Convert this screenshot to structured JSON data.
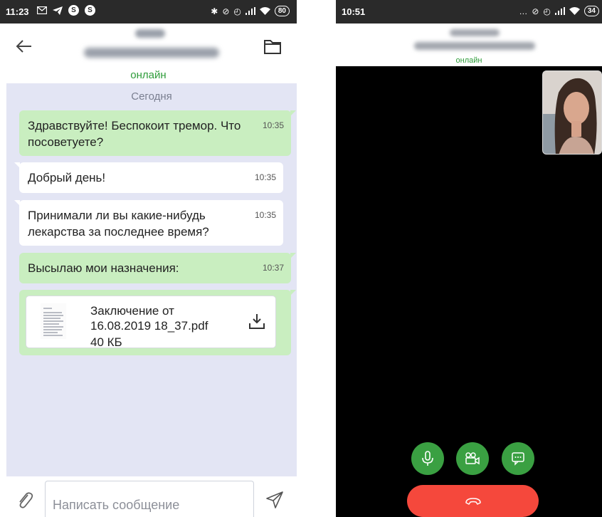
{
  "left": {
    "status_bar": {
      "time": "11:23",
      "battery": "80",
      "s1": "S",
      "s2": "S"
    },
    "header": {
      "status": "онлайн"
    },
    "chat": {
      "date_label": "Сегодня",
      "messages": [
        {
          "text": "Здравствуйте! Беспокоит тремор. Что посоветуете?",
          "time": "10:35",
          "direction": "out"
        },
        {
          "text": "Добрый день!",
          "time": "10:35",
          "direction": "in"
        },
        {
          "text": "Принимали ли вы какие-нибудь лекарства за последнее время?",
          "time": "10:35",
          "direction": "in"
        },
        {
          "text": "Высылаю мои назначения:",
          "time": "10:37",
          "direction": "out"
        }
      ],
      "attachment": {
        "name": "Заключение от 16.08.2019 18_37.pdf",
        "size": "40 КБ"
      }
    },
    "input": {
      "placeholder": "Написать сообщение"
    }
  },
  "right": {
    "status_bar": {
      "time": "10:51",
      "battery": "34"
    },
    "header": {
      "status": "онлайн"
    }
  },
  "colors": {
    "online": "#2e9c3a",
    "out_bubble": "#c9eec0",
    "chat_bg": "#e3e5f4",
    "call_button": "#3aa042",
    "hangup": "#f5483c"
  },
  "icons": [
    "back-arrow-icon",
    "folder-icon",
    "download-icon",
    "paperclip-icon",
    "send-icon",
    "microphone-icon",
    "video-camera-icon",
    "chat-icon",
    "hang-up-icon"
  ]
}
